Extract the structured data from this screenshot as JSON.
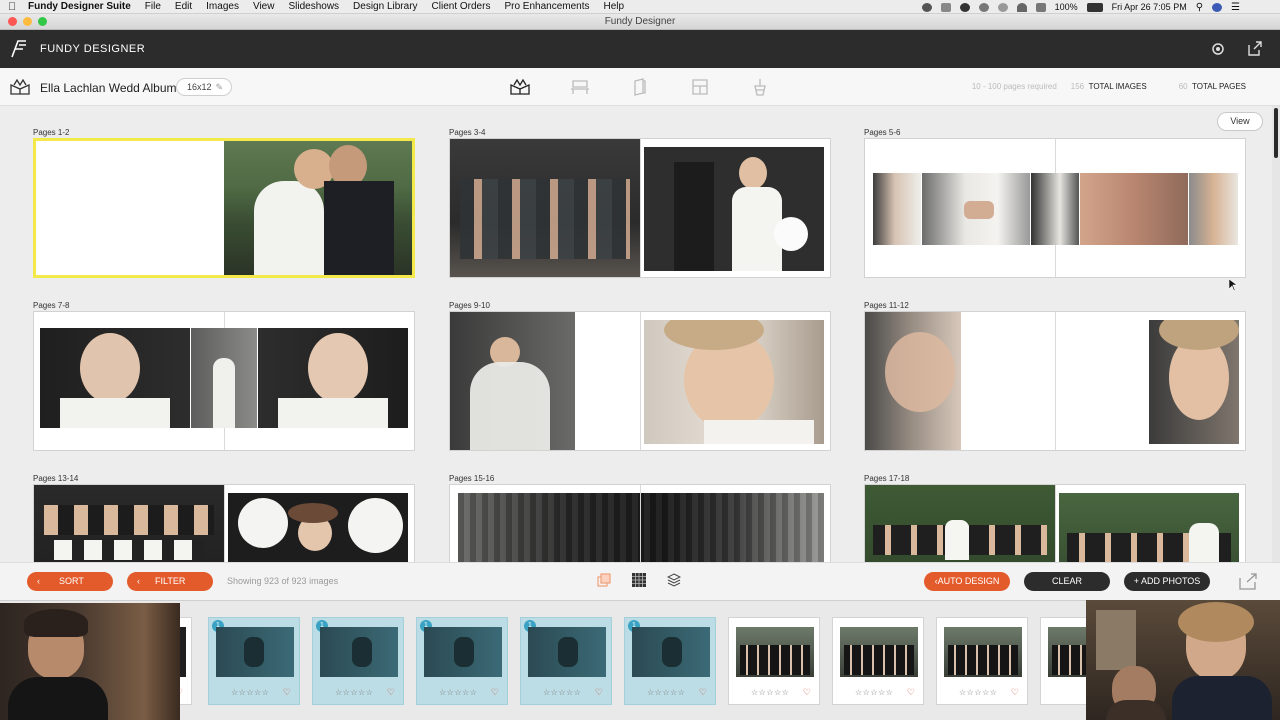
{
  "menubar": {
    "app_name": "Fundy Designer Suite",
    "items": [
      "File",
      "Edit",
      "Images",
      "View",
      "Slideshows",
      "Design Library",
      "Client Orders",
      "Pro Enhancements",
      "Help"
    ],
    "battery": "100%",
    "clock": "Fri Apr 26  7:05 PM"
  },
  "window": {
    "title": "Fundy Designer"
  },
  "appbar": {
    "brand": "FUNDY DESIGNER"
  },
  "album": {
    "name": "Ella Lachlan Wedd Album",
    "size": "16x12",
    "pages_required": "10 - 100 pages required",
    "total_images_count": "156",
    "total_images_label": "TOTAL IMAGES",
    "total_pages_count": "60",
    "total_pages_label": "TOTAL PAGES"
  },
  "workspace": {
    "view_button": "View",
    "spreads": [
      {
        "label": "Pages 1-2"
      },
      {
        "label": "Pages 3-4"
      },
      {
        "label": "Pages 5-6"
      },
      {
        "label": "Pages 7-8"
      },
      {
        "label": "Pages 9-10"
      },
      {
        "label": "Pages 11-12"
      },
      {
        "label": "Pages 13-14"
      },
      {
        "label": "Pages 15-16"
      },
      {
        "label": "Pages 17-18"
      }
    ]
  },
  "bottombar": {
    "sort": "SORT",
    "filter": "FILTER",
    "showing": "Showing 923 of 923 images",
    "auto_design": "AUTO DESIGN",
    "clear": "CLEAR",
    "add_photos": "+ ADD PHOTOS"
  },
  "tray": {
    "badge": "1",
    "stars": "☆☆☆☆☆",
    "heart": "♡"
  },
  "colors": {
    "accent_orange": "#e35a2b",
    "selected_yellow": "#f3e94a",
    "used_thumb_blue": "#bcdde6",
    "dark_bar": "#2c2c2c"
  }
}
